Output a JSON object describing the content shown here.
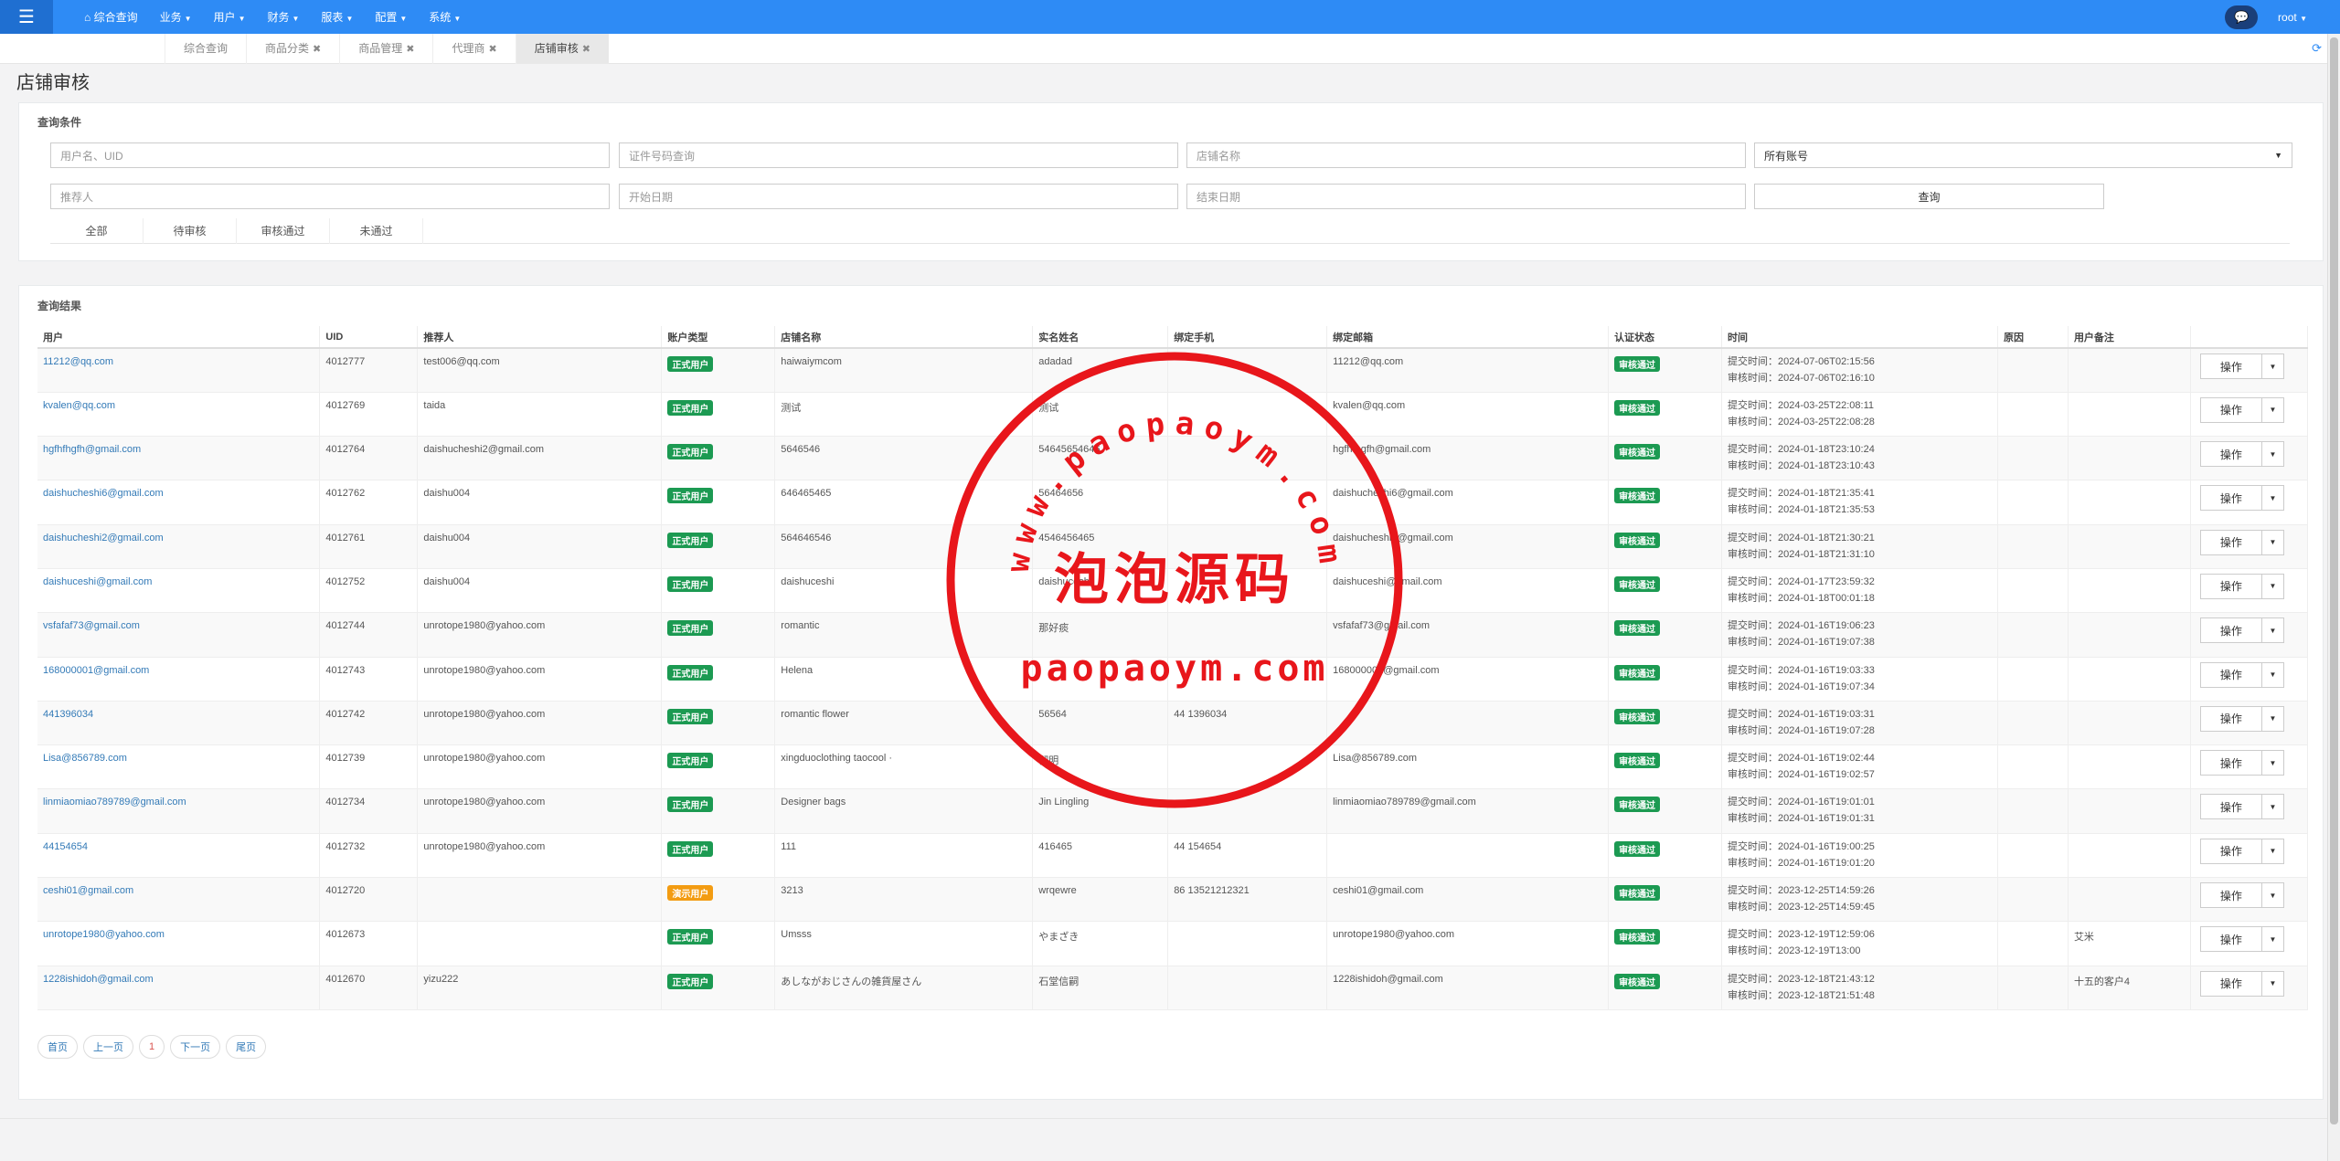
{
  "topnav": {
    "menu": [
      {
        "label": "综合查询",
        "icon": "home-icon"
      },
      {
        "label": "业务"
      },
      {
        "label": "用户"
      },
      {
        "label": "财务"
      },
      {
        "label": "服表"
      },
      {
        "label": "配置"
      },
      {
        "label": "系统"
      }
    ],
    "user": "root"
  },
  "tabs": [
    {
      "label": "综合查询",
      "closable": false
    },
    {
      "label": "商品分类",
      "closable": true
    },
    {
      "label": "商品管理",
      "closable": true
    },
    {
      "label": "代理商",
      "closable": true
    },
    {
      "label": "店铺审核",
      "closable": true,
      "active": true
    }
  ],
  "page_title": "店铺审核",
  "search": {
    "title": "查询条件",
    "user_placeholder": "用户名、UID",
    "cert_placeholder": "证件号码查询",
    "shop_placeholder": "店铺名称",
    "account_select": "所有账号",
    "referrer_placeholder": "推荐人",
    "start_placeholder": "开始日期",
    "end_placeholder": "结束日期",
    "query_label": "查询",
    "filters": [
      "全部",
      "待审核",
      "审核通过",
      "未通过"
    ]
  },
  "results": {
    "title": "查询结果",
    "columns": [
      "用户",
      "UID",
      "推荐人",
      "账户类型",
      "店铺名称",
      "实名姓名",
      "绑定手机",
      "绑定邮箱",
      "认证状态",
      "时间",
      "原因",
      "用户备注",
      ""
    ],
    "submit_prefix": "提交时间：",
    "review_prefix": "审核时间：",
    "op_label": "操作",
    "rows": [
      {
        "user": "11212@qq.com",
        "uid": "4012777",
        "ref": "test006@qq.com",
        "type": "正式用户",
        "shop": "haiwaiymcom",
        "name": "adadad",
        "phone": "",
        "email": "11212@qq.com",
        "status": "审核通过",
        "submit": "2024-07-06T02:15:56",
        "review": "2024-07-06T02:16:10",
        "reason": "",
        "note": ""
      },
      {
        "user": "kvalen@qq.com",
        "uid": "4012769",
        "ref": "taida",
        "type": "正式用户",
        "shop": "测试",
        "name": "测试",
        "phone": "",
        "email": "kvalen@qq.com",
        "status": "审核通过",
        "submit": "2024-03-25T22:08:11",
        "review": "2024-03-25T22:08:28",
        "reason": "",
        "note": ""
      },
      {
        "user": "hgfhfhgfh@gmail.com",
        "uid": "4012764",
        "ref": "daishucheshi2@gmail.com",
        "type": "正式用户",
        "shop": "5646546",
        "name": "54645654646",
        "phone": "",
        "email": "hgfhfhgfh@gmail.com",
        "status": "审核通过",
        "submit": "2024-01-18T23:10:24",
        "review": "2024-01-18T23:10:43",
        "reason": "",
        "note": ""
      },
      {
        "user": "daishucheshi6@gmail.com",
        "uid": "4012762",
        "ref": "daishu004",
        "type": "正式用户",
        "shop": "646465465",
        "name": "56464656",
        "phone": "",
        "email": "daishucheshi6@gmail.com",
        "status": "审核通过",
        "submit": "2024-01-18T21:35:41",
        "review": "2024-01-18T21:35:53",
        "reason": "",
        "note": ""
      },
      {
        "user": "daishucheshi2@gmail.com",
        "uid": "4012761",
        "ref": "daishu004",
        "type": "正式用户",
        "shop": "564646546",
        "name": "4546456465",
        "phone": "",
        "email": "daishucheshi2@gmail.com",
        "status": "审核通过",
        "submit": "2024-01-18T21:30:21",
        "review": "2024-01-18T21:31:10",
        "reason": "",
        "note": ""
      },
      {
        "user": "daishuceshi@gmail.com",
        "uid": "4012752",
        "ref": "daishu004",
        "type": "正式用户",
        "shop": "daishuceshi",
        "name": "daishuceshi",
        "phone": "",
        "email": "daishuceshi@gmail.com",
        "status": "审核通过",
        "submit": "2024-01-17T23:59:32",
        "review": "2024-01-18T00:01:18",
        "reason": "",
        "note": ""
      },
      {
        "user": "vsfafaf73@gmail.com",
        "uid": "4012744",
        "ref": "unrotope1980@yahoo.com",
        "type": "正式用户",
        "shop": "romantic",
        "name": "那好痰",
        "phone": "",
        "email": "vsfafaf73@gmail.com",
        "status": "审核通过",
        "submit": "2024-01-16T19:06:23",
        "review": "2024-01-16T19:07:38",
        "reason": "",
        "note": ""
      },
      {
        "user": "168000001@gmail.com",
        "uid": "4012743",
        "ref": "unrotope1980@yahoo.com",
        "type": "正式用户",
        "shop": "Helena",
        "name": "",
        "phone": "",
        "email": "168000001@gmail.com",
        "status": "审核通过",
        "submit": "2024-01-16T19:03:33",
        "review": "2024-01-16T19:07:34",
        "reason": "",
        "note": ""
      },
      {
        "user": "441396034",
        "uid": "4012742",
        "ref": "unrotope1980@yahoo.com",
        "type": "正式用户",
        "shop": "romantic flower",
        "name": "56564",
        "phone": "44 1396034",
        "email": "",
        "status": "审核通过",
        "submit": "2024-01-16T19:03:31",
        "review": "2024-01-16T19:07:28",
        "reason": "",
        "note": ""
      },
      {
        "user": "Lisa@856789.com",
        "uid": "4012739",
        "ref": "unrotope1980@yahoo.com",
        "type": "正式用户",
        "shop": "xingduoclothing taocool ·",
        "name": "彻明",
        "phone": "",
        "email": "Lisa@856789.com",
        "status": "审核通过",
        "submit": "2024-01-16T19:02:44",
        "review": "2024-01-16T19:02:57",
        "reason": "",
        "note": ""
      },
      {
        "user": "linmiaomiao789789@gmail.com",
        "uid": "4012734",
        "ref": "unrotope1980@yahoo.com",
        "type": "正式用户",
        "shop": "Designer bags",
        "name": "Jin Lingling",
        "phone": "",
        "email": "linmiaomiao789789@gmail.com",
        "status": "审核通过",
        "submit": "2024-01-16T19:01:01",
        "review": "2024-01-16T19:01:31",
        "reason": "",
        "note": ""
      },
      {
        "user": "44154654",
        "uid": "4012732",
        "ref": "unrotope1980@yahoo.com",
        "type": "正式用户",
        "shop": "111",
        "name": "416465",
        "phone": "44 154654",
        "email": "",
        "status": "审核通过",
        "submit": "2024-01-16T19:00:25",
        "review": "2024-01-16T19:01:20",
        "reason": "",
        "note": ""
      },
      {
        "user": "ceshi01@gmail.com",
        "uid": "4012720",
        "ref": "",
        "type": "演示用户",
        "shop": "3213",
        "name": "wrqewre",
        "phone": "86 13521212321",
        "email": "ceshi01@gmail.com",
        "status": "审核通过",
        "submit": "2023-12-25T14:59:26",
        "review": "2023-12-25T14:59:45",
        "reason": "",
        "note": ""
      },
      {
        "user": "unrotope1980@yahoo.com",
        "uid": "4012673",
        "ref": "",
        "type": "正式用户",
        "shop": "Umsss",
        "name": "やまざき",
        "phone": "",
        "email": "unrotope1980@yahoo.com",
        "status": "审核通过",
        "submit": "2023-12-19T12:59:06",
        "review": "2023-12-19T13:00",
        "reason": "",
        "note": "艾米"
      },
      {
        "user": "1228ishidoh@gmail.com",
        "uid": "4012670",
        "ref": "yizu222",
        "type": "正式用户",
        "shop": "あしながおじさんの雑貨屋さん",
        "name": "石堂信嗣",
        "phone": "",
        "email": "1228ishidoh@gmail.com",
        "status": "审核通过",
        "submit": "2023-12-18T21:43:12",
        "review": "2023-12-18T21:51:48",
        "reason": "",
        "note": "十五的客户4"
      }
    ]
  },
  "pager": {
    "first": "首页",
    "prev": "上一页",
    "current": "1",
    "next": "下一页",
    "last": "尾页"
  },
  "watermark": {
    "top_text": "www.paopaoym.com",
    "center_text": "泡泡源码",
    "bottom_text": "paopaoym.com",
    "color": "#e8161b"
  }
}
